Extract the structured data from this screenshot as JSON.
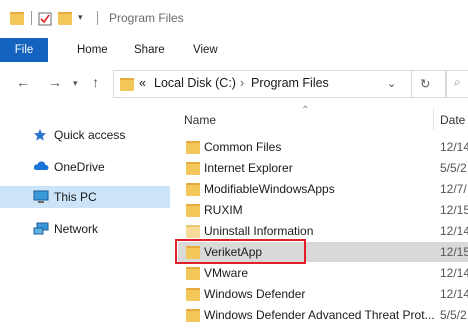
{
  "window": {
    "title": "Program Files"
  },
  "ribbon": {
    "tabs": [
      "File",
      "Home",
      "Share",
      "View"
    ]
  },
  "address": {
    "crumbs": [
      "Local Disk (C:)",
      "Program Files"
    ],
    "overflow": "«",
    "separator": "›"
  },
  "nav": {
    "items": [
      {
        "label": "Quick access",
        "icon": "star-icon",
        "selected": false
      },
      {
        "label": "OneDrive",
        "icon": "cloud-icon",
        "selected": false
      },
      {
        "label": "This PC",
        "icon": "monitor-icon",
        "selected": true
      },
      {
        "label": "Network",
        "icon": "network-icon",
        "selected": false
      }
    ]
  },
  "columns": {
    "name": "Name",
    "date": "Date"
  },
  "files": [
    {
      "name": "Common Files",
      "date": "12/14"
    },
    {
      "name": "Internet Explorer",
      "date": "5/5/2"
    },
    {
      "name": "ModifiableWindowsApps",
      "date": "12/7/"
    },
    {
      "name": "RUXIM",
      "date": "12/15"
    },
    {
      "name": "Uninstall Information",
      "date": "12/14"
    },
    {
      "name": "VeriketApp",
      "date": "12/15",
      "selected": true
    },
    {
      "name": "VMware",
      "date": "12/14"
    },
    {
      "name": "Windows Defender",
      "date": "12/14"
    },
    {
      "name": "Windows Defender Advanced Threat Prot...",
      "date": "5/5/2"
    }
  ],
  "colors": {
    "accent": "#1463bf",
    "folder": "#f4c75a",
    "highlight": "#e0202a"
  }
}
